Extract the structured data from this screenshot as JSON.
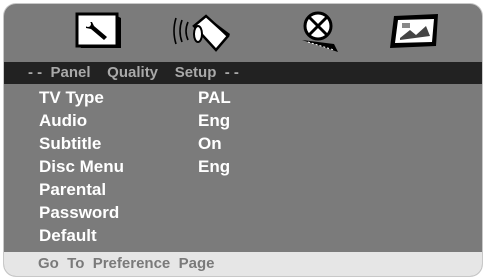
{
  "icons": [
    "wrench-icon",
    "speaker-icon",
    "disc-satellite-icon",
    "picture-frame-icon"
  ],
  "tabbar": {
    "label": "- -  Panel    Quality    Setup  - -"
  },
  "menu": [
    {
      "label": "TV Type",
      "value": "PAL"
    },
    {
      "label": "Audio",
      "value": "Eng"
    },
    {
      "label": "Subtitle",
      "value": "On"
    },
    {
      "label": "Disc Menu",
      "value": "Eng"
    },
    {
      "label": "Parental",
      "value": ""
    },
    {
      "label": "Password",
      "value": ""
    },
    {
      "label": "Default",
      "value": ""
    }
  ],
  "footer": {
    "label": "Go  To  Preference  Page"
  }
}
